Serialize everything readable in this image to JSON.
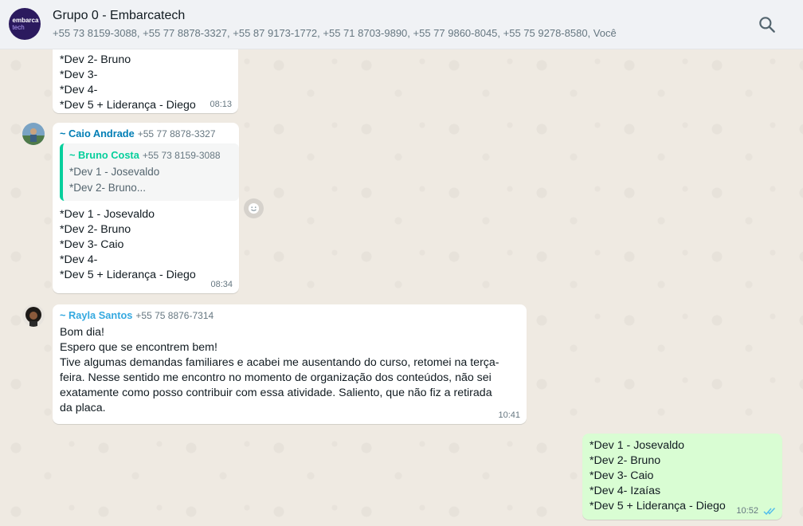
{
  "header": {
    "title": "Grupo 0 - Embarcatech",
    "participants": "+55 73 8159-3088, +55 77 8878-3327, +55 87 9173-1772, +55 71 8703-9890, +55 77 9860-8045, +55 75 9278-8580, Você",
    "avatar_line1": "embarca",
    "avatar_line2": "tech"
  },
  "messages": [
    {
      "lines": "*Dev 2- Bruno\n*Dev 3-\n*Dev 4-\n*Dev 5 + Liderança - Diego",
      "time": "08:13"
    },
    {
      "sender": "~ Caio Andrade",
      "sender_phone": "+55 77 8878-3327",
      "quote_sender": "~ Bruno Costa",
      "quote_phone": "+55 73 8159-3088",
      "quote_text": "*Dev 1 - Josevaldo\n*Dev 2- Bruno...",
      "lines": "*Dev 1 - Josevaldo\n*Dev 2- Bruno\n*Dev 3- Caio\n*Dev 4-\n*Dev 5 + Liderança - Diego",
      "time": "08:34"
    },
    {
      "sender": "~ Rayla Santos",
      "sender_phone": "+55 75 8876-7314",
      "lines": "Bom dia!\nEspero que se encontrem bem!\nTive algumas demandas familiares e acabei me ausentando do curso, retomei na terça-\nfeira. Nesse sentido me encontro no momento de organização dos conteúdos, não sei\nexatamente como posso contribuir com essa atividade. Saliento, que não fiz a retirada\nda placa.",
      "time": "10:41"
    },
    {
      "lines": "*Dev 1 - Josevaldo\n*Dev 2- Bruno\n*Dev 3- Caio\n*Dev 4- Izaías\n*Dev 5 + Liderança - Diego",
      "time": "10:52"
    }
  ],
  "colors": {
    "caio_name": "#027eb5",
    "rayla_name": "#35a9e0",
    "quote_accent": "#06cf9c",
    "read_ticks": "#53bdeb"
  },
  "icons": {
    "search": "search-icon",
    "react": "emoji-react-icon",
    "ticks": "double-check-icon"
  }
}
